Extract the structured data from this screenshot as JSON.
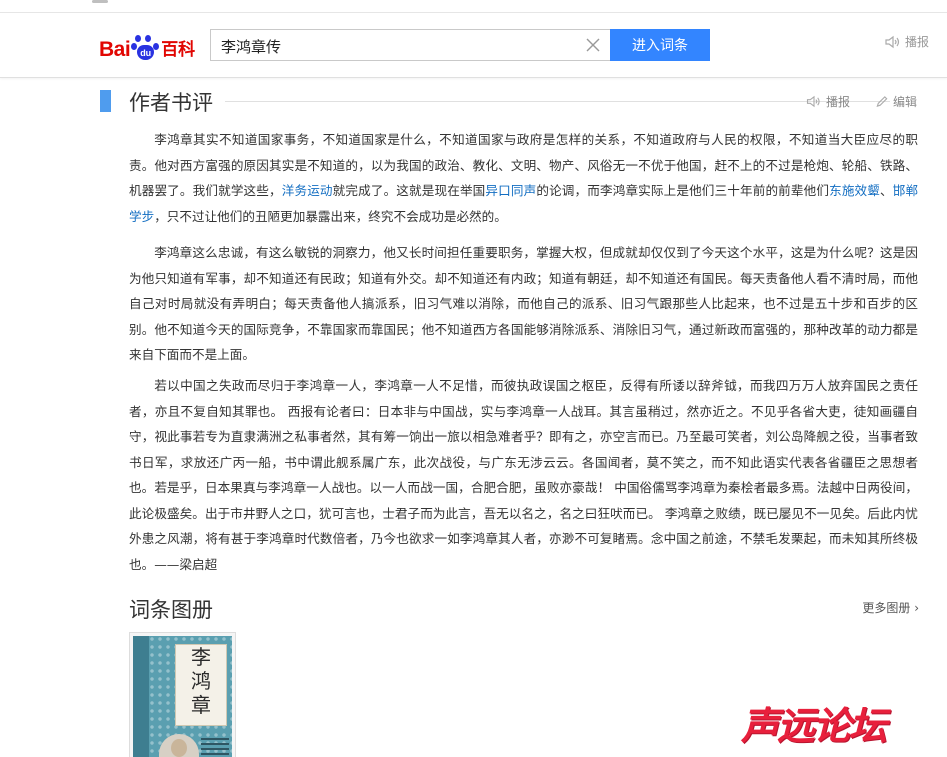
{
  "header": {
    "logo_bai": "Bai",
    "logo_du": "du",
    "logo_baike": "百科",
    "search_value": "李鸿章传",
    "search_button": "进入词条",
    "play_label": "播报"
  },
  "section": {
    "title": "作者书评",
    "play_label": "播报",
    "edit_label": "编辑"
  },
  "paragraphs": {
    "p1": {
      "t1": "李鸿章其实不知道国家事务，不知道国家是什么，不知道国家与政府是怎样的关系，不知道政府与人民的权限，不知道当大臣应尽的职责。他对西方富强的原因其实是不知道的，以为我国的政治、教化、文明、物产、风俗无一不优于他国，赶不上的不过是枪炮、轮船、铁路、机器罢了。我们就学这些，",
      "link1": "洋务运动",
      "t2": "就完成了。这就是现在举国",
      "link2": "异口同声",
      "t3": "的论调，而李鸿章实际上是他们三十年前的前辈他们",
      "link3": "东施效颦",
      "t4": "、",
      "link4": "邯郸学步",
      "t5": "，只不过让他们的丑陋更加暴露出来，终究不会成功是必然的。"
    },
    "p2": "李鸿章这么忠诚，有这么敏锐的洞察力，他又长时间担任重要职务，掌握大权，但成就却仅仅到了今天这个水平，这是为什么呢？这是因为他只知道有军事，却不知道还有民政；知道有外交。却不知道还有内政；知道有朝廷，却不知道还有国民。每天责备他人看不清时局，而他自己对时局就没有弄明白；每天责备他人搞派系，旧习气难以消除，而他自己的派系、旧习气跟那些人比起来，也不过是五十步和百步的区别。他不知道今天的国际竞争，不靠国家而靠国民；他不知道西方各国能够消除派系、消除旧习气，通过新政而富强的，那种改革的动力都是来自下面而不是上面。",
    "p3": "若以中国之失政而尽归于李鸿章一人，李鸿章一人不足惜，而彼执政误国之枢臣，反得有所诿以辞斧钺，而我四万万人放弃国民之责任者，亦且不复自知其罪也。 西报有论者曰：日本非与中国战，实与李鸿章一人战耳。其言虽稍过，然亦近之。不见乎各省大吏，徒知画疆自守，视此事若专为直隶满洲之私事者然，其有筹一饷出一旅以相急难者乎？即有之，亦空言而已。乃至最可笑者，刘公岛降舰之役，当事者致书日军，求放还广丙一船，书中谓此舰系属广东，此次战役，与广东无涉云云。各国闻者，莫不笑之，而不知此语实代表各省疆臣之思想者也。若是乎，日本果真与李鸿章一人战也。以一人而战一国，合肥合肥，虽败亦豪哉！ 中国俗儒骂李鸿章为秦桧者最多焉。法越中日两役间，此论极盛矣。出于市井野人之口，犹可言也，士君子而为此言，吾无以名之，名之曰狂吠而已。 李鸿章之败绩，既已屡见不一见矣。后此内忧外患之风潮，将有甚于李鸿章时代数倍者，乃今也欲求一如李鸿章其人者，亦渺不可复睹焉。念中国之前途，不禁毛发栗起，而未知其所终极也。——梁启超"
  },
  "album": {
    "title": "词条图册",
    "more_label": "更多图册",
    "cover_title_chars": [
      "李",
      "鸿",
      "章"
    ]
  },
  "watermark": "声远论坛",
  "colors": {
    "accent_blue": "#3385ff",
    "link_blue": "#136ec2",
    "section_bar": "#4f9cee",
    "baidu_red": "#e10602",
    "baidu_blue": "#2932e1",
    "watermark_red": "#e8203c"
  }
}
